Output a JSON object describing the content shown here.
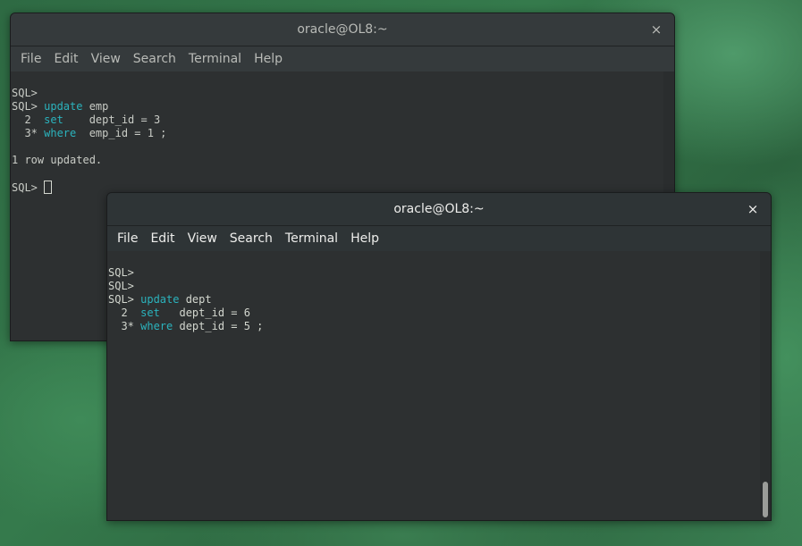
{
  "back_window": {
    "title": "oracle@OL8:~",
    "close_glyph": "×",
    "menu": [
      "File",
      "Edit",
      "View",
      "Search",
      "Terminal",
      "Help"
    ],
    "lines": [
      {
        "prefix": "SQL>",
        "kw": "",
        "rest": ""
      },
      {
        "prefix": "SQL> ",
        "kw": "update",
        "rest": " emp"
      },
      {
        "prefix": "  2  ",
        "kw": "set",
        "rest": "    dept_id = 3"
      },
      {
        "prefix": "  3* ",
        "kw": "where",
        "rest": "  emp_id = 1 ;"
      },
      {
        "prefix": "",
        "kw": "",
        "rest": ""
      },
      {
        "prefix": "1 row updated.",
        "kw": "",
        "rest": ""
      },
      {
        "prefix": "",
        "kw": "",
        "rest": ""
      },
      {
        "prefix": "SQL> ",
        "kw": "",
        "rest": ""
      }
    ]
  },
  "front_window": {
    "title": "oracle@OL8:~",
    "close_glyph": "×",
    "menu": [
      "File",
      "Edit",
      "View",
      "Search",
      "Terminal",
      "Help"
    ],
    "lines": [
      {
        "prefix": "SQL>",
        "kw": "",
        "rest": ""
      },
      {
        "prefix": "SQL>",
        "kw": "",
        "rest": ""
      },
      {
        "prefix": "SQL> ",
        "kw": "update",
        "rest": " dept"
      },
      {
        "prefix": "  2  ",
        "kw": "set",
        "rest": "   dept_id = 6"
      },
      {
        "prefix": "  3* ",
        "kw": "where",
        "rest": " dept_id = 5 ;"
      }
    ]
  },
  "colors": {
    "keyword": "#2bb3bd",
    "terminal_bg": "#2d3031",
    "text": "#d3d7cf",
    "desktop": "#2f6b40"
  },
  "icons": {
    "close": "close-icon"
  }
}
